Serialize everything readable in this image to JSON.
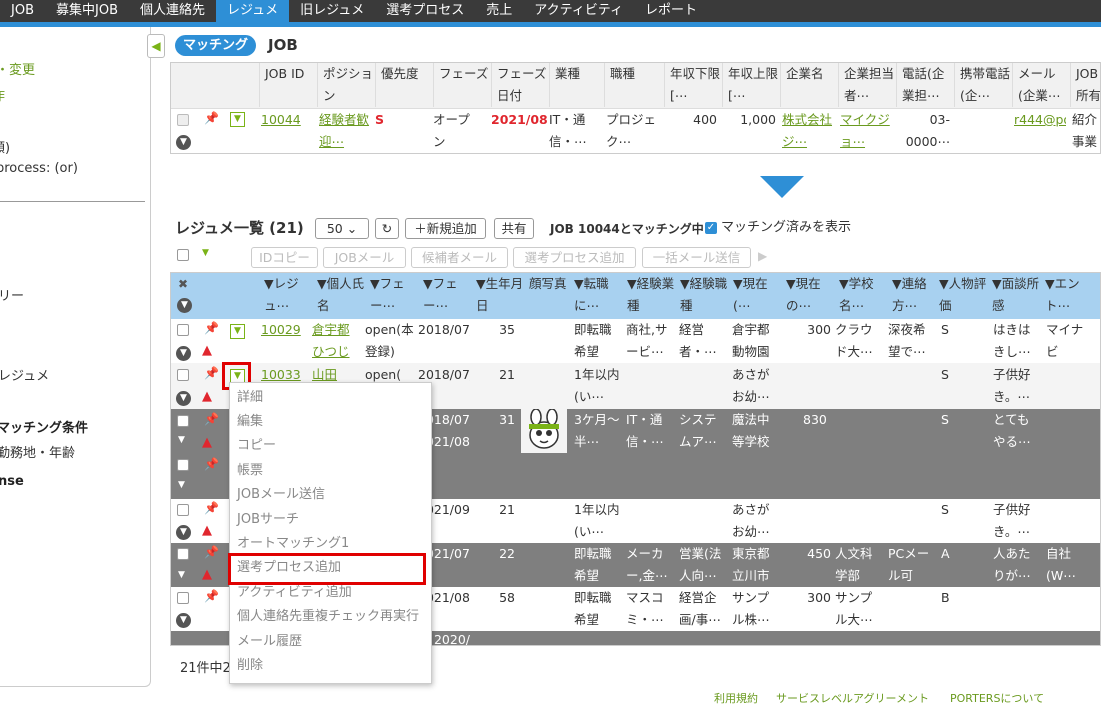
{
  "nav": {
    "tabs": [
      "JOB",
      "募集中JOB",
      "個人連絡先",
      "レジュメ",
      "旧レジュメ",
      "選考プロセス",
      "売上",
      "アクティビティ",
      "レポート"
    ],
    "active": "レジュメ"
  },
  "sidebar": {
    "lines": [
      "・変更",
      "作",
      "額)",
      "process: (or)",
      "リー",
      "レジュメ",
      "マッチング条件",
      "勤務地・年齢",
      "nse"
    ]
  },
  "matching": {
    "badge": "マッチング",
    "title": "JOB",
    "columns": [
      "JOB ID",
      "ポジション",
      "優先度",
      "フェーズ",
      "フェーズ日付",
      "業種",
      "職種",
      "年収下限 [⋯",
      "年収上限 [⋯",
      "企業名",
      "企業担当者⋯",
      "電話(企業担⋯",
      "携帯電話(企⋯",
      "メール(企業⋯",
      "JOB所有"
    ],
    "row": {
      "job_id": "10044",
      "position": "経験者歓迎⋯",
      "priority": "S",
      "phase": "オープン",
      "phase_date": "2021/08/1⋯",
      "industry": "IT・通信・⋯",
      "job_type": "プロジェク⋯",
      "salary_min": "400",
      "salary_max": "1,000",
      "company": "株式会社ジ⋯",
      "contact": "マイクジョ⋯",
      "phone": "03-0000⋯",
      "mobile": "",
      "email": "r444@porte⋯",
      "owner": "紹介事業部"
    }
  },
  "resume_list": {
    "title": "レジュメ一覧 (21)",
    "page_size": "50",
    "new_button": "＋新規追加",
    "share_button": "共有",
    "matching_status": "JOB 10044とマッチング中",
    "show_matched_label": "マッチング済みを表示",
    "actions": [
      "IDコピー",
      "JOBメール",
      "候補者メール",
      "選考プロセス追加",
      "一括メール送信"
    ],
    "columns": [
      "▼レジュ⋯",
      "▼個人氏名",
      "▼フェー⋯",
      "▼フェー⋯",
      "▼生年月日",
      "顔写真",
      "▼転職に⋯",
      "▼経験業種",
      "▼経験職種",
      "▼現在(⋯",
      "▼現在の⋯",
      "▼学校名⋯",
      "▼連絡方⋯",
      "▼人物評価",
      "▼面談所感",
      "▼エント⋯"
    ],
    "rows": [
      {
        "id": "10029",
        "name": "倉宇都ひつじ",
        "phase": "open(本登録)",
        "date": "2018/07/0⋯",
        "age": "35",
        "change": "即転職希望",
        "industry": "商社,サービ⋯",
        "job": "経営者・⋯",
        "current": "倉宇都動物園",
        "salary": "300",
        "school": "クラウド大⋯",
        "contact": "深夜希望で⋯",
        "rank": "S",
        "memo": "はきはきし⋯",
        "entry": "マイナビ"
      },
      {
        "id": "10033",
        "name": "山田",
        "phase": "open(",
        "date": "2018/07/2⋯",
        "age": "21",
        "change": "1年以内(い⋯",
        "industry": "",
        "job": "",
        "current": "あさがお幼⋯",
        "salary": "",
        "school": "",
        "contact": "",
        "rank": "S",
        "memo": "子供好き。⋯",
        "entry": ""
      },
      {
        "id": "",
        "name": "",
        "phase": "",
        "date": "2018/07/2⋯\n2021/08/1⋯",
        "age": "31",
        "change": "3ケ月～半⋯",
        "industry": "IT・通信・⋯",
        "job": "システムア⋯",
        "current": "魔法中等学校",
        "salary": "830",
        "school": "",
        "contact": "",
        "rank": "S",
        "memo": "とてもやる⋯",
        "entry": ""
      },
      {
        "id": "",
        "name": "",
        "phase": "",
        "date": "2021/09/0⋯",
        "age": "21",
        "change": "1年以内(い⋯",
        "industry": "",
        "job": "",
        "current": "あさがお幼⋯",
        "salary": "",
        "school": "",
        "contact": "",
        "rank": "S",
        "memo": "子供好き。⋯",
        "entry": ""
      },
      {
        "id": "",
        "name": "",
        "phase": "",
        "date": "2021/07/2⋯",
        "age": "22",
        "change": "即転職希望",
        "industry": "メーカー,金⋯",
        "job": "営業(法人向⋯",
        "current": "東京都立川市",
        "salary": "450",
        "school": "人文科学部",
        "contact": "PCメール可",
        "rank": "A",
        "memo": "人あたりが⋯",
        "entry": "自社(W⋯"
      },
      {
        "id": "",
        "name": "",
        "phase": "",
        "date": "2021/08/1⋯",
        "age": "58",
        "change": "即転職希望",
        "industry": "マスコミ・⋯",
        "job": "経営企画/事⋯",
        "current": "サンプル株⋯",
        "salary": "300",
        "school": "サンプル大⋯",
        "contact": "",
        "rank": "B",
        "memo": "",
        "entry": ""
      },
      {
        "id": "",
        "name": "",
        "phase": "",
        "date": "2020/",
        "age": "",
        "change": "",
        "industry": "",
        "job": "",
        "current": "",
        "salary": "",
        "school": "",
        "contact": "",
        "rank": "",
        "memo": "",
        "entry": ""
      }
    ],
    "footer_count": "21件中2"
  },
  "context_menu": {
    "items": [
      "詳細",
      "編集",
      "コピー",
      "帳票",
      "JOBメール送信",
      "JOBサーチ",
      "オートマッチング1",
      "選考プロセス追加",
      "アクティビティ追加",
      "個人連絡先重複チェック再実行",
      "メール履歴",
      "削除"
    ],
    "highlighted": "選考プロセス追加"
  },
  "footer_links": [
    "利用規約",
    "サービスレベルアグリーメント",
    "PORTERSについて"
  ],
  "colors": {
    "nav_bg": "#3a3a3a",
    "accent_blue": "#2e8fd6",
    "header_blue": "#a8d1f0",
    "link_green": "#6a9a1f",
    "highlight_red": "#e00000",
    "selected_row": "#7f7f7f"
  }
}
